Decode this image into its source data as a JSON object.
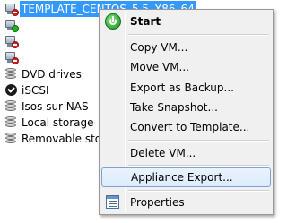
{
  "tree": {
    "selected_vm": "TEMPLATE_CENTOS_5.5_X86_64",
    "vms": [
      {
        "state": "stopped"
      },
      {
        "state": "running"
      },
      {
        "state": "stopped"
      }
    ],
    "storage": [
      {
        "label": "DVD drives",
        "icon": "disk-icon"
      },
      {
        "label": "iSCSI",
        "icon": "iscsi-icon"
      },
      {
        "label": "Isos sur NAS",
        "icon": "disk-icon"
      },
      {
        "label": "Local storage",
        "icon": "disk-icon"
      },
      {
        "label": "Removable stora",
        "icon": "disk-icon"
      }
    ]
  },
  "context_menu": {
    "items": [
      {
        "label": "Start",
        "icon": "start-icon",
        "bold": true
      },
      {
        "label": "Copy VM..."
      },
      {
        "label": "Move VM..."
      },
      {
        "label": "Export as Backup..."
      },
      {
        "label": "Take Snapshot..."
      },
      {
        "label": "Convert to Template..."
      },
      {
        "label": "Delete VM..."
      },
      {
        "label": "Appliance Export...",
        "hovered": true
      },
      {
        "label": "Properties",
        "icon": "properties-icon"
      }
    ]
  },
  "colors": {
    "selection": "#3399ff",
    "menu_background": "#f0f0f0",
    "hover_border": "#7da2ce",
    "vm_stopped_badge": "#d61f1f",
    "vm_running_badge": "#1fb21f"
  }
}
